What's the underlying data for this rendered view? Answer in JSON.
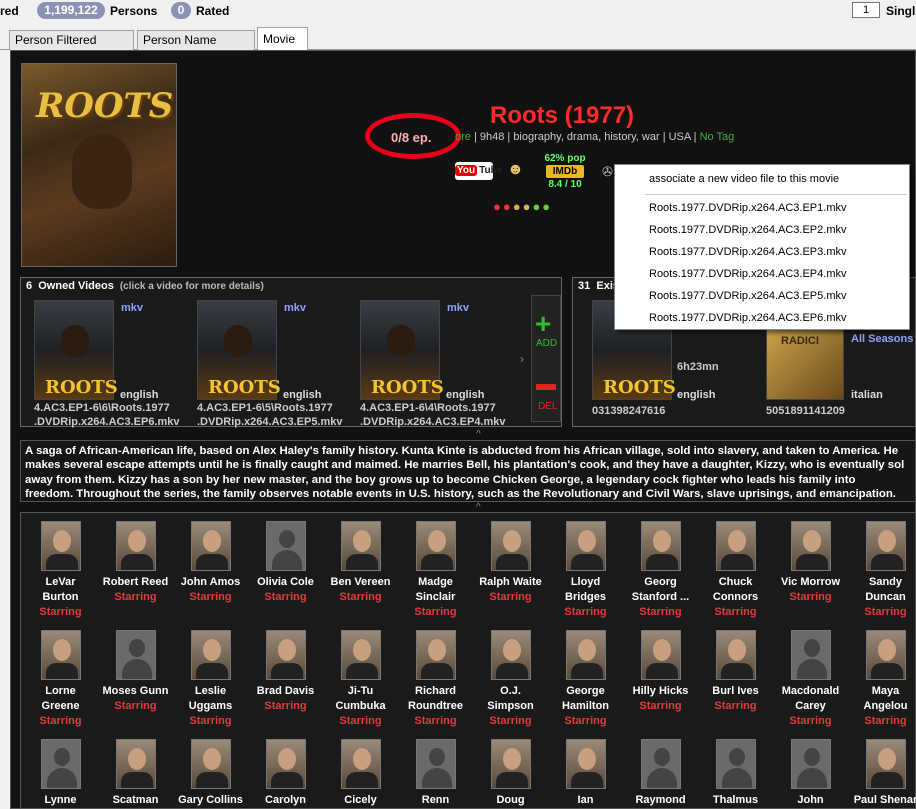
{
  "topbar": {
    "left_label": "red",
    "persons_count": "1,199,122",
    "persons_label": "Persons",
    "rated_count": "0",
    "rated_label": "Rated",
    "single_value": "1",
    "single_label": "Singl"
  },
  "tabs": [
    {
      "label": "Person Filtered Search"
    },
    {
      "label": "Person Name Search"
    },
    {
      "label": "Movie"
    }
  ],
  "movie": {
    "title": "Roots (1977)",
    "episodes": "0/8 ep.",
    "meta_more": "ore",
    "meta_text": " | 9h48 | biography, drama, history, war | USA | ",
    "meta_tag": "No Tag",
    "imdb_pop": "62% pop",
    "imdb_logo": "IMDb",
    "imdb_score": "8.4 / 10",
    "youtube_label": "You",
    "youtube_label2": "Tube"
  },
  "context_menu": {
    "items": [
      "associate a new video file to this movie",
      "Roots.1977.DVDRip.x264.AC3.EP1.mkv",
      "Roots.1977.DVDRip.x264.AC3.EP2.mkv",
      "Roots.1977.DVDRip.x264.AC3.EP3.mkv",
      "Roots.1977.DVDRip.x264.AC3.EP4.mkv",
      "Roots.1977.DVDRip.x264.AC3.EP5.mkv",
      "Roots.1977.DVDRip.x264.AC3.EP6.mkv"
    ]
  },
  "owned": {
    "count": "6",
    "title": "Owned Videos",
    "hint": "(click a video for more details)",
    "videos": [
      {
        "format": "mkv",
        "language": "english",
        "line1": "4.AC3.EP1-6\\6\\Roots.1977",
        "line2": ".DVDRip.x264.AC3.EP6.mkv"
      },
      {
        "format": "mkv",
        "language": "english",
        "line1": "4.AC3.EP1-6\\5\\Roots.1977",
        "line2": ".DVDRip.x264.AC3.EP5.mkv"
      },
      {
        "format": "mkv",
        "language": "english",
        "line1": "4.AC3.EP1-6\\4\\Roots.1977",
        "line2": ".DVDRip.x264.AC3.EP4.mkv"
      }
    ],
    "add_label": "ADD",
    "del_label": "DEL"
  },
  "existing": {
    "count": "31",
    "title": "Exis",
    "duration": "6h23mn",
    "language1": "english",
    "code1": "031398247616",
    "seasons_label": "All Seasons",
    "language2": "italian",
    "code2": "5051891141209",
    "radio_label": "RADICI"
  },
  "synopsis": {
    "lines": [
      "A saga of African-American life, based on Alex Haley's family history. Kunta Kinte is abducted from his African village, sold into slavery, and taken to America. He",
      "makes several escape attempts until he is finally caught and maimed. He marries Bell, his plantation's cook, and they have a daughter, Kizzy, who is eventually sol",
      "away from them. Kizzy has a son by her new master, and the boy grows up to become Chicken George, a legendary cock fighter who leads his family into",
      "freedom. Throughout the series, the family observes notable events in U.S. history, such as the Revolutionary and Civil Wars, slave uprisings, and emancipation."
    ]
  },
  "cast": {
    "row1": [
      {
        "name1": "LeVar",
        "name2": "Burton",
        "role": "Starring",
        "photo": "real"
      },
      {
        "name1": "Robert Reed",
        "name2": "",
        "role": "Starring",
        "photo": "real"
      },
      {
        "name1": "John Amos",
        "name2": "",
        "role": "Starring",
        "photo": "real"
      },
      {
        "name1": "Olivia Cole",
        "name2": "",
        "role": "Starring",
        "photo": "empty"
      },
      {
        "name1": "Ben Vereen",
        "name2": "",
        "role": "Starring",
        "photo": "real"
      },
      {
        "name1": "Madge",
        "name2": "Sinclair",
        "role": "Starring",
        "photo": "real"
      },
      {
        "name1": "Ralph Waite",
        "name2": "",
        "role": "Starring",
        "photo": "real"
      },
      {
        "name1": "Lloyd",
        "name2": "Bridges",
        "role": "Starring",
        "photo": "real"
      },
      {
        "name1": "Georg",
        "name2": "Stanford ...",
        "role": "Starring",
        "photo": "real"
      },
      {
        "name1": "Chuck",
        "name2": "Connors",
        "role": "Starring",
        "photo": "real"
      },
      {
        "name1": "Vic Morrow",
        "name2": "",
        "role": "Starring",
        "photo": "real"
      },
      {
        "name1": "Sandy",
        "name2": "Duncan",
        "role": "Starring",
        "photo": "real"
      }
    ],
    "row2": [
      {
        "name1": "Lorne",
        "name2": "Greene",
        "role": "Starring",
        "photo": "real"
      },
      {
        "name1": "Moses Gunn",
        "name2": "",
        "role": "Starring",
        "photo": "empty"
      },
      {
        "name1": "Leslie",
        "name2": "Uggams",
        "role": "Starring",
        "photo": "real"
      },
      {
        "name1": "Brad Davis",
        "name2": "",
        "role": "Starring",
        "photo": "real"
      },
      {
        "name1": "Ji-Tu",
        "name2": "Cumbuka",
        "role": "Starring",
        "photo": "real"
      },
      {
        "name1": "Richard",
        "name2": "Roundtree",
        "role": "Starring",
        "photo": "real"
      },
      {
        "name1": "O.J.",
        "name2": "Simpson",
        "role": "Starring",
        "photo": "real"
      },
      {
        "name1": "George",
        "name2": "Hamilton",
        "role": "Starring",
        "photo": "real"
      },
      {
        "name1": "Hilly Hicks",
        "name2": "",
        "role": "Starring",
        "photo": "real"
      },
      {
        "name1": "Burl Ives",
        "name2": "",
        "role": "Starring",
        "photo": "real"
      },
      {
        "name1": "Macdonald",
        "name2": "Carey",
        "role": "Starring",
        "photo": "empty"
      },
      {
        "name1": "Maya",
        "name2": "Angelou",
        "role": "Starring",
        "photo": "real"
      }
    ],
    "row3": [
      {
        "name1": "Lynne",
        "photo": "empty"
      },
      {
        "name1": "Scatman",
        "photo": "real"
      },
      {
        "name1": "Gary Collins",
        "photo": "real"
      },
      {
        "name1": "Carolyn",
        "photo": "real"
      },
      {
        "name1": "Cicely",
        "photo": "real"
      },
      {
        "name1": "Renn",
        "photo": "empty"
      },
      {
        "name1": "Doug",
        "photo": "real"
      },
      {
        "name1": "Ian",
        "photo": "real"
      },
      {
        "name1": "Raymond",
        "photo": "empty"
      },
      {
        "name1": "Thalmus",
        "photo": "empty"
      },
      {
        "name1": "John",
        "photo": "empty"
      },
      {
        "name1": "Paul Shenar",
        "photo": "real"
      }
    ]
  }
}
